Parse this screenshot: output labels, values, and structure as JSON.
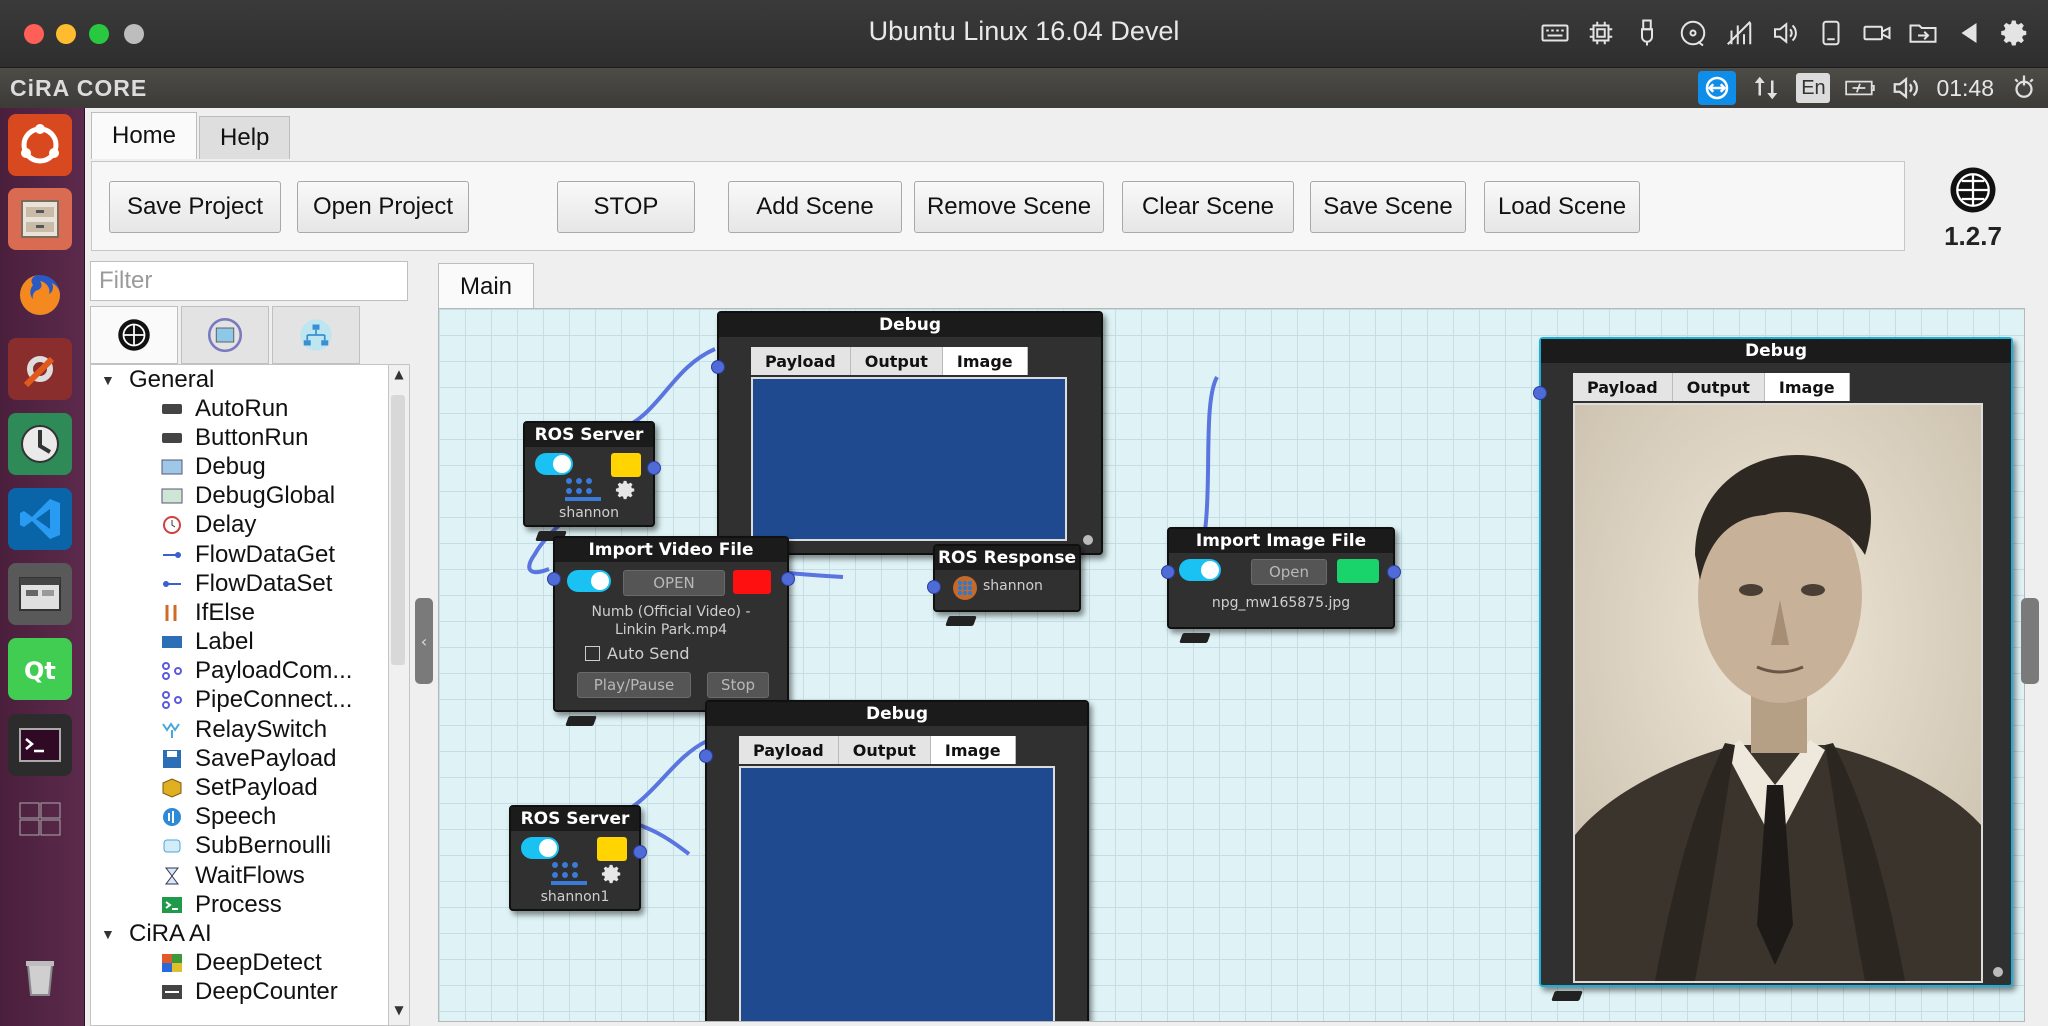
{
  "window": {
    "title": "Ubuntu Linux 16.04 Devel"
  },
  "panel": {
    "app_name": "CiRA CORE",
    "lang": "En",
    "clock": "01:48"
  },
  "menu_tabs": [
    "Home",
    "Help"
  ],
  "toolbar": {
    "save_project": "Save Project",
    "open_project": "Open Project",
    "stop": "STOP",
    "add_scene": "Add Scene",
    "remove_scene": "Remove Scene",
    "clear_scene": "Clear Scene",
    "save_scene": "Save Scene",
    "load_scene": "Load Scene",
    "version": "1.2.7"
  },
  "filter": {
    "placeholder": "Filter",
    "value": ""
  },
  "library": {
    "groups": [
      {
        "name": "General",
        "items": [
          "AutoRun",
          "ButtonRun",
          "Debug",
          "DebugGlobal",
          "Delay",
          "FlowDataGet",
          "FlowDataSet",
          "IfElse",
          "Label",
          "PayloadCom...",
          "PipeConnect...",
          "RelaySwitch",
          "SavePayload",
          "SetPayload",
          "Speech",
          "SubBernoulli",
          "WaitFlows",
          "Process"
        ]
      },
      {
        "name": "CiRA AI",
        "items": [
          "DeepDetect",
          "DeepCounter"
        ]
      }
    ]
  },
  "canvas": {
    "tab": "Main"
  },
  "nodes": {
    "ros_server_1": {
      "title": "ROS Server",
      "label": "shannon"
    },
    "ros_server_2": {
      "title": "ROS Server",
      "label": "shannon1"
    },
    "import_video": {
      "title": "Import Video File",
      "open": "OPEN",
      "file": [
        "Numb (Official Video) -",
        "Linkin Park.mp4"
      ],
      "auto_send": "Auto Send",
      "play_pause": "Play/Pause",
      "stop": "Stop"
    },
    "ros_response": {
      "title": "ROS Response",
      "label": "shannon"
    },
    "import_image": {
      "title": "Import Image File",
      "open": "Open",
      "file": "npg_mw165875.jpg"
    },
    "debug": {
      "title": "Debug",
      "tabs": [
        "Payload",
        "Output",
        "Image"
      ]
    }
  },
  "colors": {
    "wire": "#5a74e0",
    "canvas": "#dff3f6",
    "debug_body": "#1f4a8f",
    "toggle": "#19c2f2",
    "video_swatch": "#ff1010",
    "image_swatch": "#19d46a",
    "ros_swatch": "#ffd400"
  }
}
